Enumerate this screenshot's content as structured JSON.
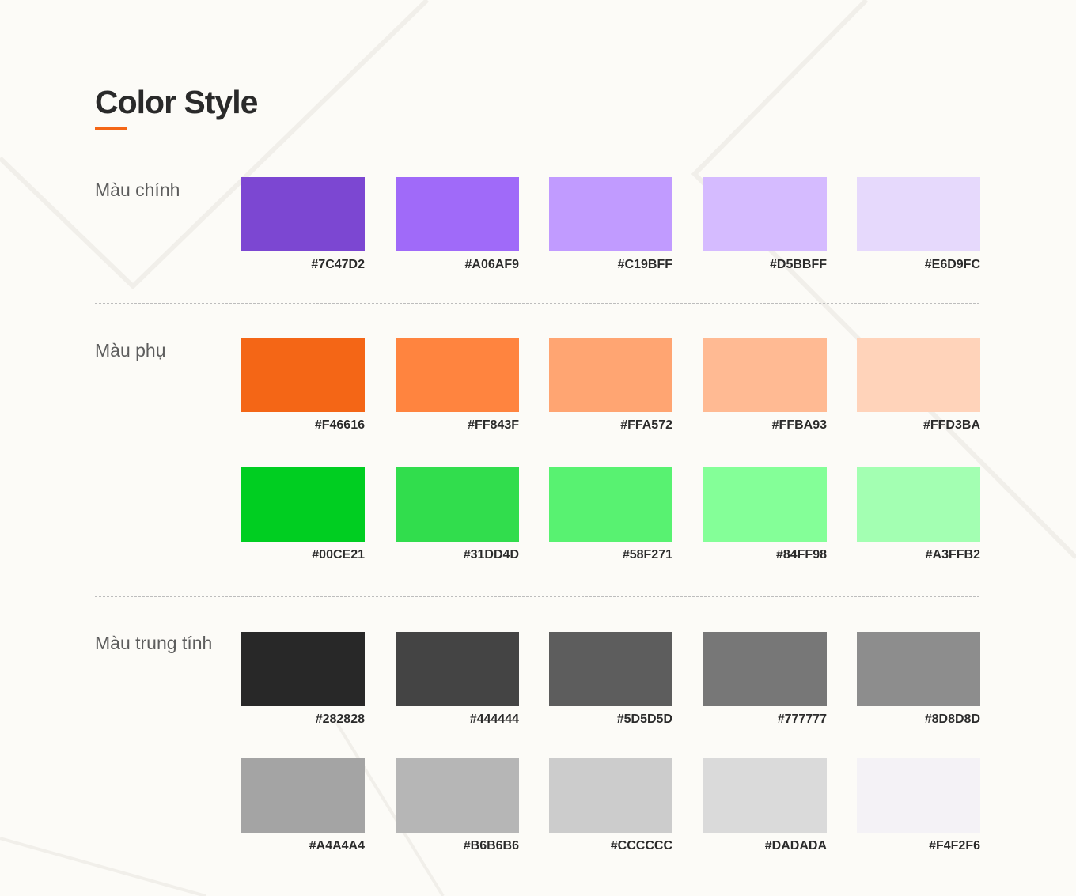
{
  "title": "Color Style",
  "accent": "#F46616",
  "sections": [
    {
      "label": "Màu chính",
      "rows": [
        [
          "#7C47D2",
          "#A06AF9",
          "#C19BFF",
          "#D5BBFF",
          "#E6D9FC"
        ]
      ]
    },
    {
      "label": "Màu phụ",
      "rows": [
        [
          "#F46616",
          "#FF843F",
          "#FFA572",
          "#FFBA93",
          "#FFD3BA"
        ],
        [
          "#00CE21",
          "#31DD4D",
          "#58F271",
          "#84FF98",
          "#A3FFB2"
        ]
      ]
    },
    {
      "label": "Màu trung tính",
      "rows": [
        [
          "#282828",
          "#444444",
          "#5D5D5D",
          "#777777",
          "#8D8D8D"
        ],
        [
          "#A4A4A4",
          "#B6B6B6",
          "#CCCCCC",
          "#DADADA",
          "#F4F2F6"
        ]
      ]
    }
  ]
}
